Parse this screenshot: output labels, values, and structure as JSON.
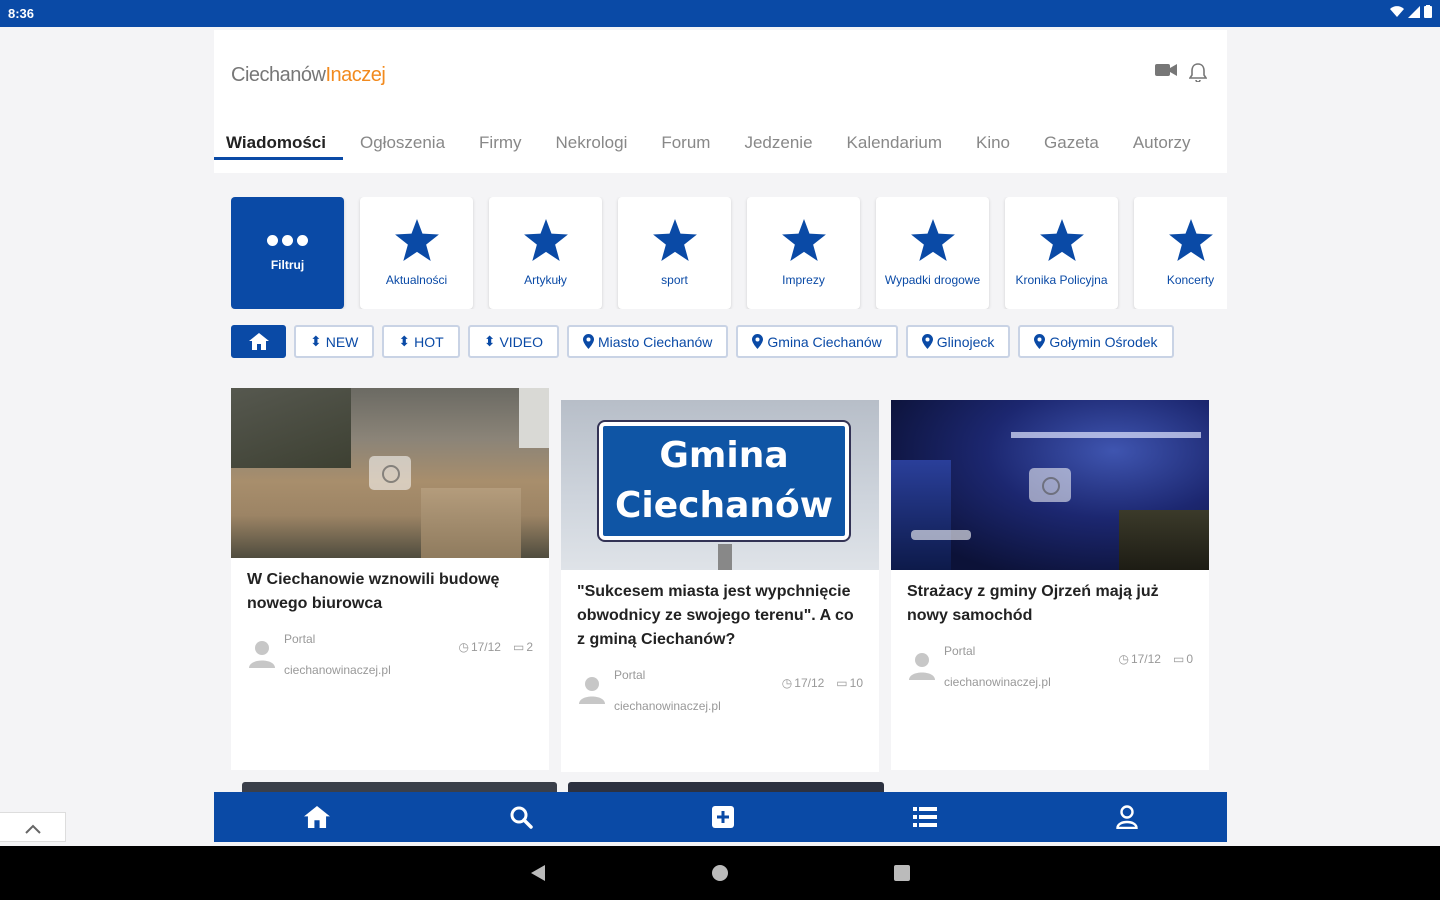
{
  "status": {
    "time": "8:36"
  },
  "logo": {
    "part1": "Ciechanów",
    "part2": "Inaczej"
  },
  "tabs": [
    {
      "label": "Wiadomości"
    },
    {
      "label": "Ogłoszenia"
    },
    {
      "label": "Firmy"
    },
    {
      "label": "Nekrologi"
    },
    {
      "label": "Forum"
    },
    {
      "label": "Jedzenie"
    },
    {
      "label": "Kalendarium"
    },
    {
      "label": "Kino"
    },
    {
      "label": "Gazeta"
    },
    {
      "label": "Autorzy"
    }
  ],
  "categories": [
    {
      "label": "Filtruj"
    },
    {
      "label": "Aktualności"
    },
    {
      "label": "Artykuły"
    },
    {
      "label": "sport"
    },
    {
      "label": "Imprezy"
    },
    {
      "label": "Wypadki drogowe"
    },
    {
      "label": "Kronika Policyjna"
    },
    {
      "label": "Koncerty"
    }
  ],
  "chips": [
    {
      "label": "NEW"
    },
    {
      "label": "HOT"
    },
    {
      "label": "VIDEO"
    },
    {
      "label": "Miasto Ciechanów"
    },
    {
      "label": "Gmina Ciechanów"
    },
    {
      "label": "Glinojeck"
    },
    {
      "label": "Gołymin Ośrodek"
    }
  ],
  "articles": [
    {
      "title": "W Ciechanowie wznowili budowę nowego biurowca",
      "source1": "Portal",
      "source2": "ciechanowinaczej.pl",
      "date": "17/12",
      "comments": "2"
    },
    {
      "title": "\"Sukcesem miasta jest wypchnięcie obwodnicy ze swojego terenu\". A co z gminą Ciechanów?",
      "source1": "Portal",
      "source2": "ciechanowinaczej.pl",
      "date": "17/12",
      "comments": "10",
      "sign1": "Gmina",
      "sign2": "Ciechanów"
    },
    {
      "title": "Strażacy z gminy Ojrzeń mają już nowy samochód",
      "source1": "Portal",
      "source2": "ciechanowinaczej.pl",
      "date": "17/12",
      "comments": "0"
    }
  ],
  "colors": {
    "primary": "#0a4aa6",
    "accent": "#f28a1e"
  }
}
